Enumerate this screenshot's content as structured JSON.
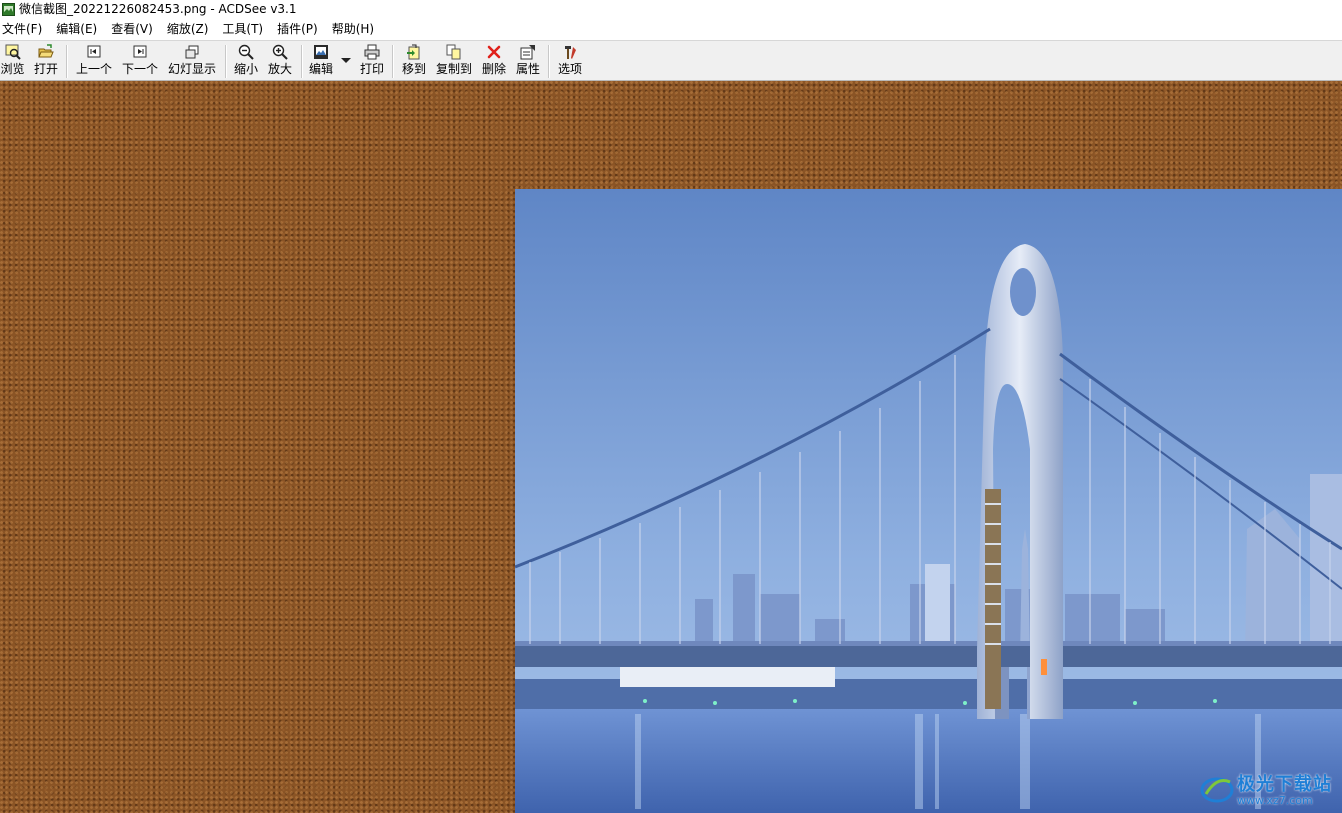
{
  "window": {
    "title": "微信截图_20221226082453.png - ACDSee v3.1"
  },
  "menu": [
    {
      "label": "文件(F)"
    },
    {
      "label": "编辑(E)"
    },
    {
      "label": "查看(V)"
    },
    {
      "label": "缩放(Z)"
    },
    {
      "label": "工具(T)"
    },
    {
      "label": "插件(P)"
    },
    {
      "label": "帮助(H)"
    }
  ],
  "toolbar": {
    "browse": "浏览",
    "open": "打开",
    "prev": "上一个",
    "next": "下一个",
    "slideshow": "幻灯显示",
    "zoom_out": "缩小",
    "zoom_in": "放大",
    "edit": "编辑",
    "print": "打印",
    "move_to": "移到",
    "copy_to": "复制到",
    "delete": "删除",
    "properties": "属性",
    "options": "选项"
  },
  "colors": {
    "viewer_background": "#8a5425",
    "toolbar_background": "#f0f0f0",
    "delete_icon": "#e0201a",
    "watermark": "#1f7fd6"
  },
  "watermark": {
    "title": "极光下载站",
    "url": "www.xz7.com"
  }
}
